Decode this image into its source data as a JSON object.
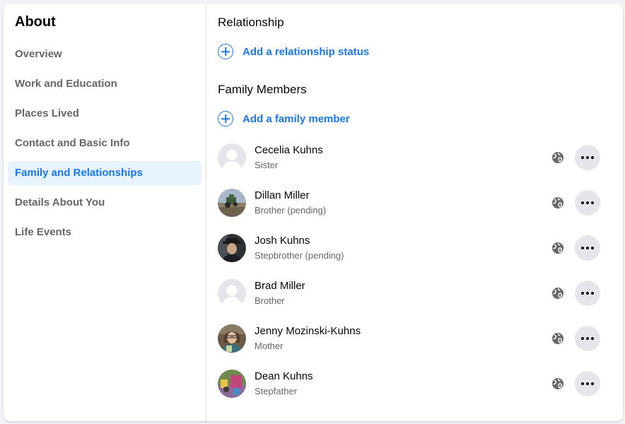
{
  "sidebar": {
    "title": "About",
    "items": [
      {
        "label": "Overview"
      },
      {
        "label": "Work and Education"
      },
      {
        "label": "Places Lived"
      },
      {
        "label": "Contact and Basic Info"
      },
      {
        "label": "Family and Relationships",
        "active": true
      },
      {
        "label": "Details About You"
      },
      {
        "label": "Life Events"
      }
    ]
  },
  "relationship": {
    "title": "Relationship",
    "add_label": "Add a relationship status"
  },
  "family": {
    "title": "Family Members",
    "add_label": "Add a family member",
    "members": [
      {
        "name": "Cecelia Kuhns",
        "relation": "Sister",
        "avatar": "default-avatar",
        "privacy_icon": "globe-icon"
      },
      {
        "name": "Dillan Miller",
        "relation": "Brother (pending)",
        "avatar": "photo-tractor-field",
        "privacy_icon": "globe-icon"
      },
      {
        "name": "Josh Kuhns",
        "relation": "Stepbrother (pending)",
        "avatar": "photo-man-hat",
        "privacy_icon": "globe-icon"
      },
      {
        "name": "Brad Miller",
        "relation": "Brother",
        "avatar": "default-avatar",
        "privacy_icon": "globe-icon"
      },
      {
        "name": "Jenny Mozinski-Kuhns",
        "relation": "Mother",
        "avatar": "photo-woman-glasses",
        "privacy_icon": "globe-icon"
      },
      {
        "name": "Dean Kuhns",
        "relation": "Stepfather",
        "avatar": "photo-colorful-scene",
        "privacy_icon": "globe-icon"
      }
    ]
  },
  "colors": {
    "accent": "#1877f2",
    "active_bg": "#e7f3ff",
    "secondary_text": "#65676b",
    "button_bg": "#e4e6eb"
  }
}
